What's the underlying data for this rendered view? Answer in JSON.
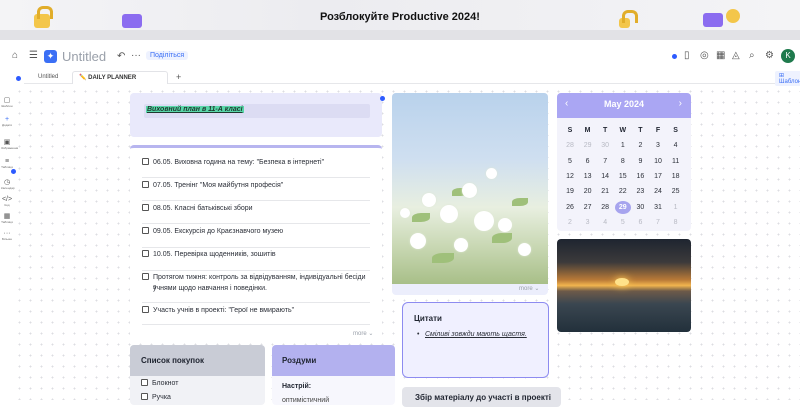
{
  "banner": {
    "text": "Розблокуйте Productive 2024!"
  },
  "header": {
    "title": "Untitled",
    "share_label": "Поділіться",
    "avatar_letter": "K"
  },
  "tabs": [
    {
      "label": "Untitled"
    },
    {
      "label": "✏️ DAILY PLANNER"
    }
  ],
  "tab_add": "+",
  "templates_label": "⊞ Шаблони",
  "left_rail": [
    {
      "label": "Шаблон"
    },
    {
      "label": "Додати"
    },
    {
      "label": "Зображення"
    },
    {
      "label": "Таблиця"
    },
    {
      "label": "Календар"
    },
    {
      "label": "Код"
    },
    {
      "label": "Таблиця"
    },
    {
      "label": "Більше"
    }
  ],
  "title_block": {
    "text": "Виховний план в 11-А класі"
  },
  "todo": {
    "items": [
      "06.05. Виховна година на тему: \"Безпека в інтернеті\"",
      "07.05. Тренінг \"Моя майбутня професія\"",
      "08.05. Класні батьківські збори",
      "09.05. Екскурсія до Краєзнавчого музею",
      "10.05. Перевірка щоденників, зошитів",
      "Протягом тижня: контроль за відвідуванням, індивідуальні бесіди з",
      "учнями щодо навчання і поведінки.",
      "Участь учнів в проекті: \"Герої не вмирають\""
    ],
    "more_label": "more"
  },
  "shopping": {
    "title": "Список покупок",
    "items": [
      "Блокнот",
      "Ручка"
    ]
  },
  "thoughts": {
    "title": "Роздуми",
    "mood_label": "Настрій:",
    "mood_value": "оптимістичний"
  },
  "photo": {
    "more_label": "more"
  },
  "quotes": {
    "title": "Цитати",
    "items": [
      "Сміливі зовжди мають щастя."
    ]
  },
  "collect": {
    "title": "Збір матеріалу до участі в проекті"
  },
  "calendar": {
    "month": "May 2024",
    "prev": "‹",
    "next": "›",
    "dow": [
      "S",
      "M",
      "T",
      "W",
      "T",
      "F",
      "S"
    ],
    "weeks": [
      [
        [
          "28",
          "o"
        ],
        [
          "29",
          "o"
        ],
        [
          "30",
          "o"
        ],
        [
          "1",
          "c"
        ],
        [
          "2",
          "c"
        ],
        [
          "3",
          "c"
        ],
        [
          "4",
          "c"
        ]
      ],
      [
        [
          "5",
          "c"
        ],
        [
          "6",
          "c"
        ],
        [
          "7",
          "c"
        ],
        [
          "8",
          "c"
        ],
        [
          "9",
          "c"
        ],
        [
          "10",
          "c"
        ],
        [
          "11",
          "c"
        ]
      ],
      [
        [
          "12",
          "c"
        ],
        [
          "13",
          "c"
        ],
        [
          "14",
          "c"
        ],
        [
          "15",
          "c"
        ],
        [
          "16",
          "c"
        ],
        [
          "17",
          "c"
        ],
        [
          "18",
          "c"
        ]
      ],
      [
        [
          "19",
          "c"
        ],
        [
          "20",
          "c"
        ],
        [
          "21",
          "c"
        ],
        [
          "22",
          "c"
        ],
        [
          "23",
          "c"
        ],
        [
          "24",
          "c"
        ],
        [
          "25",
          "c"
        ]
      ],
      [
        [
          "26",
          "c"
        ],
        [
          "27",
          "c"
        ],
        [
          "28",
          "c"
        ],
        [
          "29",
          "t"
        ],
        [
          "30",
          "c"
        ],
        [
          "31",
          "c"
        ],
        [
          "1",
          "o"
        ]
      ],
      [
        [
          "2",
          "o"
        ],
        [
          "3",
          "o"
        ],
        [
          "4",
          "o"
        ],
        [
          "5",
          "o"
        ],
        [
          "6",
          "o"
        ],
        [
          "7",
          "o"
        ],
        [
          "8",
          "o"
        ]
      ]
    ]
  }
}
